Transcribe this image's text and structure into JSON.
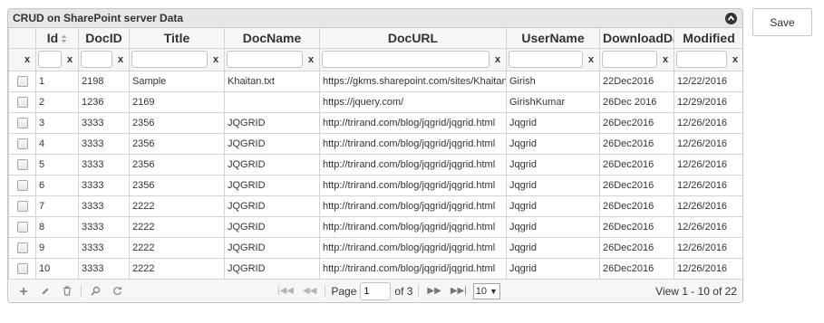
{
  "grid": {
    "caption": "CRUD on SharePoint server Data",
    "columns": [
      "",
      "Id",
      "DocID",
      "Title",
      "DocName",
      "DocURL",
      "UserName",
      "DownloadDa",
      "Modified"
    ],
    "filter_clear": "x",
    "rows": [
      [
        "1",
        "2198",
        "Sample",
        "Khaitan.txt",
        "https://gkms.sharepoint.com/sites/Khaitan",
        "Girish",
        "22Dec2016",
        "12/22/2016"
      ],
      [
        "2",
        "1236",
        "2169",
        "",
        "https://jquery.com/",
        "GirishKumar",
        "26Dec 2016",
        "12/29/2016"
      ],
      [
        "3",
        "3333",
        "2356",
        "JQGRID",
        "http://trirand.com/blog/jqgrid/jqgrid.html",
        "Jqgrid",
        "26Dec2016",
        "12/26/2016"
      ],
      [
        "4",
        "3333",
        "2356",
        "JQGRID",
        "http://trirand.com/blog/jqgrid/jqgrid.html",
        "Jqgrid",
        "26Dec2016",
        "12/26/2016"
      ],
      [
        "5",
        "3333",
        "2356",
        "JQGRID",
        "http://trirand.com/blog/jqgrid/jqgrid.html",
        "Jqgrid",
        "26Dec2016",
        "12/26/2016"
      ],
      [
        "6",
        "3333",
        "2356",
        "JQGRID",
        "http://trirand.com/blog/jqgrid/jqgrid.html",
        "Jqgrid",
        "26Dec2016",
        "12/26/2016"
      ],
      [
        "7",
        "3333",
        "2222",
        "JQGRID",
        "http://trirand.com/blog/jqgrid/jqgrid.html",
        "Jqgrid",
        "26Dec2016",
        "12/26/2016"
      ],
      [
        "8",
        "3333",
        "2222",
        "JQGRID",
        "http://trirand.com/blog/jqgrid/jqgrid.html",
        "Jqgrid",
        "26Dec2016",
        "12/26/2016"
      ],
      [
        "9",
        "3333",
        "2222",
        "JQGRID",
        "http://trirand.com/blog/jqgrid/jqgrid.html",
        "Jqgrid",
        "26Dec2016",
        "12/26/2016"
      ],
      [
        "10",
        "3333",
        "2222",
        "JQGRID",
        "http://trirand.com/blog/jqgrid/jqgrid.html",
        "Jqgrid",
        "26Dec2016",
        "12/26/2016"
      ]
    ]
  },
  "pager": {
    "icons": [
      "plus-icon",
      "edit-pencil-icon",
      "trash-icon",
      "search-icon",
      "refresh-icon"
    ],
    "page_label": "Page",
    "page_value": "1",
    "of_label": "of 3",
    "rows_per_page": "10",
    "record_info": "View 1 - 10 of 22"
  },
  "save_button": "Save"
}
